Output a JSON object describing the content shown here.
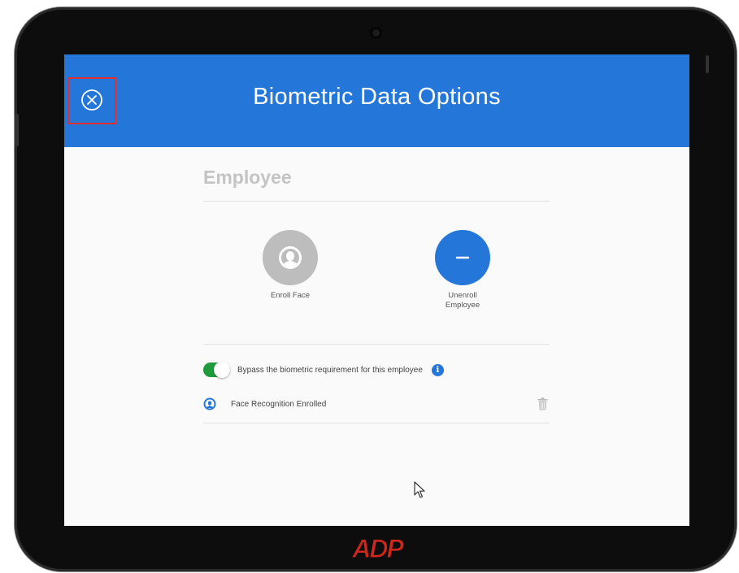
{
  "header": {
    "title": "Biometric Data Options",
    "color": "#2477d8"
  },
  "employee_section": {
    "title": "Employee"
  },
  "actions": {
    "enroll_face": {
      "label": "Enroll Face",
      "icon": "user-face-icon",
      "color": "#bdbdbd"
    },
    "unenroll_employee": {
      "label": "Unenroll\nEmployee",
      "icon": "minus-icon",
      "color": "#2477d8"
    }
  },
  "settings": {
    "bypass": {
      "label": "Bypass the biometric requirement for this employee",
      "enabled": true,
      "toggle_color": "#1f9b3e"
    },
    "face_recognition": {
      "label": "Face Recognition Enrolled",
      "icon": "user-icon",
      "delete_icon": "trash-icon"
    }
  },
  "branding": {
    "logo_text": "ADP",
    "logo_color": "#d0271d"
  },
  "highlight_color": "#e03030"
}
